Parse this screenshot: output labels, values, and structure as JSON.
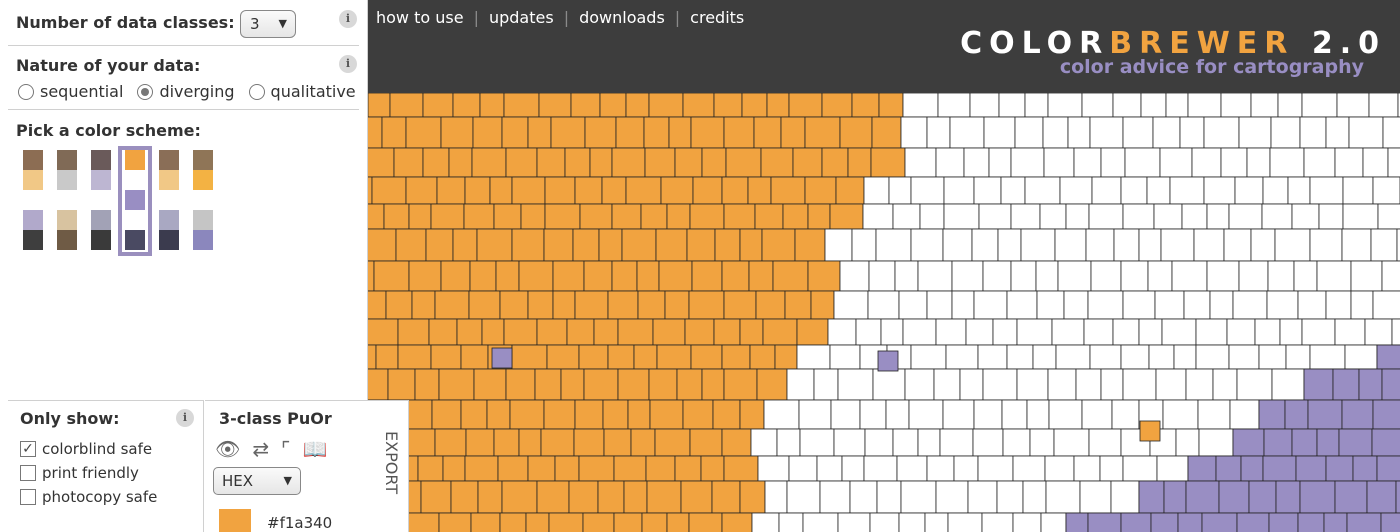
{
  "nav": {
    "items": [
      "how to use",
      "updates",
      "downloads",
      "credits"
    ]
  },
  "brand": {
    "part1": "COLOR",
    "part2": "BREWER",
    "part3": "2.0",
    "tagline": "color advice for cartography"
  },
  "panel": {
    "data_classes": {
      "label": "Number of data classes:",
      "value": "3"
    },
    "nature": {
      "label": "Nature of your data:",
      "options": [
        "sequential",
        "diverging",
        "qualitative"
      ],
      "selected": "diverging"
    },
    "scheme": {
      "label": "Pick a color scheme:",
      "schemes": [
        [
          "#8c6d53",
          "#f1c886",
          "#ffffff",
          "#b1a9cb",
          "#3e3e3e"
        ],
        [
          "#806a56",
          "#c9c9c9",
          "#ffffff",
          "#d8c3a0",
          "#6f5b45"
        ],
        [
          "#6a5a5a",
          "#bdb6d2",
          "#ffffff",
          "#a2a2b6",
          "#3a3a3a"
        ],
        [
          "#f1a340",
          "#ffffff",
          "#998ec3",
          "#ffffff",
          "#4a4a62"
        ],
        [
          "#8a6e57",
          "#f1c886",
          "#ffffff",
          "#a9a8c2",
          "#3b3b4e"
        ],
        [
          "#8f7557",
          "#f3b243",
          "#ffffff",
          "#c5c5c5",
          "#8b87bd"
        ]
      ],
      "selected_index": 3
    },
    "only_show": {
      "label": "Only show:",
      "options": [
        {
          "label": "colorblind safe",
          "checked": true
        },
        {
          "label": "print friendly",
          "checked": false
        },
        {
          "label": "photocopy safe",
          "checked": false
        }
      ]
    },
    "export": {
      "title": "3-class PuOr",
      "format": "HEX",
      "tab_label": "EXPORT",
      "icons": [
        "eye-icon",
        "transfer-icon",
        "slope-icon",
        "book-icon"
      ],
      "colors": [
        {
          "hex": "#f1a340",
          "label": "#f1a340"
        }
      ]
    },
    "info_glyph": "i"
  },
  "map": {
    "palette": {
      "orange": "#f1a340",
      "white": "#ffffff",
      "purple": "#998ec3",
      "border": "#222222"
    }
  }
}
